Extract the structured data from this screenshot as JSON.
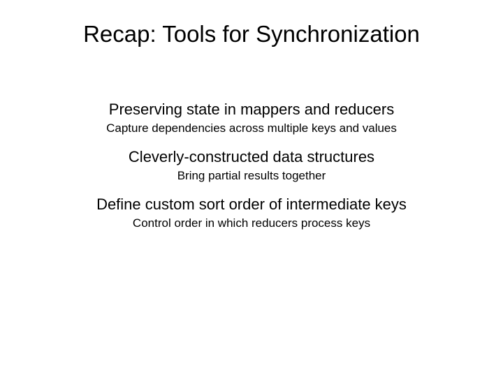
{
  "title": "Recap: Tools for Synchronization",
  "items": [
    {
      "main": "Preserving state in mappers and reducers",
      "sub": "Capture dependencies across multiple keys and values"
    },
    {
      "main": "Cleverly-constructed data structures",
      "sub": "Bring partial results together"
    },
    {
      "main": "Define custom sort order of intermediate keys",
      "sub": "Control order in which reducers process keys"
    }
  ]
}
